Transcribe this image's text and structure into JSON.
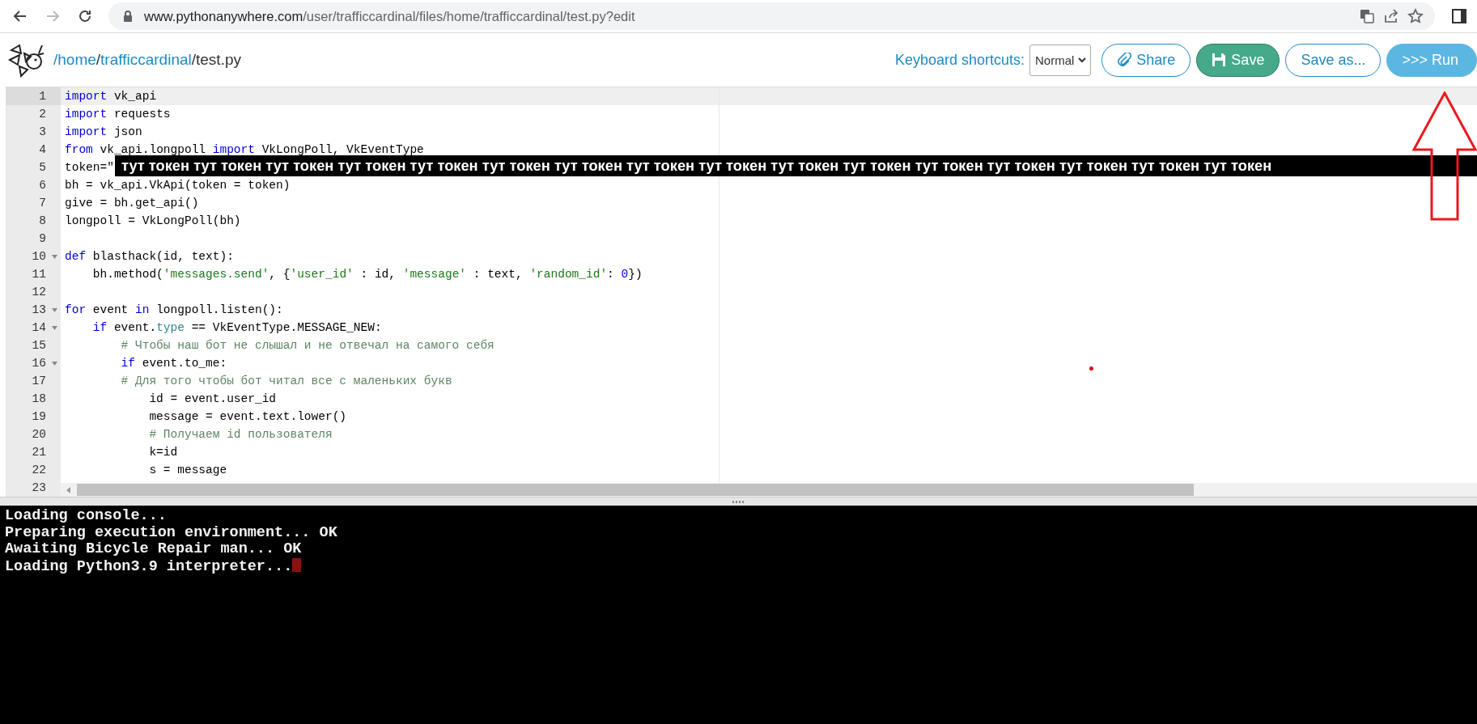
{
  "browser": {
    "nav_buttons": [
      {
        "kind": "back",
        "disabled": false
      },
      {
        "kind": "forward",
        "disabled": true
      },
      {
        "kind": "reload",
        "disabled": false
      }
    ],
    "url_host": "www.pythonanywhere.com",
    "url_path": "/user/trafficcardinal/files/home/trafficcardinal/test.py?edit"
  },
  "header": {
    "path": [
      {
        "kind": "link",
        "text": "/home"
      },
      {
        "kind": "text",
        "text": "/"
      },
      {
        "kind": "link",
        "text": "trafficcardinal"
      },
      {
        "kind": "text",
        "text": "/test.py"
      }
    ],
    "shortcuts_label": "Keyboard shortcuts:",
    "keymap": "Normal",
    "buttons": [
      {
        "kind": "share",
        "label": "Share"
      },
      {
        "kind": "save",
        "label": "Save"
      },
      {
        "kind": "saveas",
        "label": "Save as..."
      },
      {
        "kind": "run",
        "label": ">>> Run"
      }
    ]
  },
  "editor": {
    "lines": [
      {
        "number": "1",
        "active": true,
        "fold": false,
        "tokens": [
          {
            "kind": "kw",
            "text": "import"
          },
          {
            "kind": "plain",
            "text": " vk_api"
          }
        ]
      },
      {
        "number": "2",
        "active": false,
        "fold": false,
        "tokens": [
          {
            "kind": "kw",
            "text": "import"
          },
          {
            "kind": "plain",
            "text": " requests"
          }
        ]
      },
      {
        "number": "3",
        "active": false,
        "fold": false,
        "tokens": [
          {
            "kind": "kw",
            "text": "import"
          },
          {
            "kind": "plain",
            "text": " json"
          }
        ]
      },
      {
        "number": "4",
        "active": false,
        "fold": false,
        "tokens": [
          {
            "kind": "kw",
            "text": "from"
          },
          {
            "kind": "plain",
            "text": " vk_api.longpoll "
          },
          {
            "kind": "kw",
            "text": "import"
          },
          {
            "kind": "plain",
            "text": " VkLongPoll, VkEventType"
          }
        ]
      },
      {
        "number": "5",
        "active": false,
        "fold": false,
        "tokens": [
          {
            "kind": "plain",
            "text": "token=\""
          }
        ]
      },
      {
        "number": "6",
        "active": false,
        "fold": false,
        "tokens": [
          {
            "kind": "plain",
            "text": "bh = vk_api.VkApi(token = token)"
          }
        ]
      },
      {
        "number": "7",
        "active": false,
        "fold": false,
        "tokens": [
          {
            "kind": "plain",
            "text": "give = bh.get_api()"
          }
        ]
      },
      {
        "number": "8",
        "active": false,
        "fold": false,
        "tokens": [
          {
            "kind": "plain",
            "text": "longpoll = VkLongPoll(bh)"
          }
        ]
      },
      {
        "number": "9",
        "active": false,
        "fold": false
      },
      {
        "number": "10",
        "active": false,
        "fold": true,
        "tokens": [
          {
            "kind": "kw",
            "text": "def"
          },
          {
            "kind": "plain",
            "text": " blasthack(id, text):"
          }
        ]
      },
      {
        "number": "11",
        "active": false,
        "fold": false,
        "tokens": [
          {
            "kind": "plain",
            "text": "    bh.method("
          },
          {
            "kind": "str",
            "text": "'messages.send'"
          },
          {
            "kind": "plain",
            "text": ", {"
          },
          {
            "kind": "str",
            "text": "'user_id'"
          },
          {
            "kind": "plain",
            "text": " : id, "
          },
          {
            "kind": "str",
            "text": "'message'"
          },
          {
            "kind": "plain",
            "text": " : text, "
          },
          {
            "kind": "str",
            "text": "'random_id'"
          },
          {
            "kind": "plain",
            "text": ": "
          },
          {
            "kind": "num",
            "text": "0"
          },
          {
            "kind": "plain",
            "text": "})"
          }
        ]
      },
      {
        "number": "12",
        "active": false,
        "fold": false
      },
      {
        "number": "13",
        "active": false,
        "fold": true,
        "tokens": [
          {
            "kind": "kw",
            "text": "for"
          },
          {
            "kind": "plain",
            "text": " event "
          },
          {
            "kind": "kw",
            "text": "in"
          },
          {
            "kind": "plain",
            "text": " longpoll.listen():"
          }
        ]
      },
      {
        "number": "14",
        "active": false,
        "fold": true,
        "tokens": [
          {
            "kind": "kw",
            "text": "    if"
          },
          {
            "kind": "plain",
            "text": " event."
          },
          {
            "kind": "builtin",
            "text": "type"
          },
          {
            "kind": "plain",
            "text": " == VkEventType.MESSAGE_NEW:"
          }
        ]
      },
      {
        "number": "15",
        "active": false,
        "fold": false,
        "tokens": [
          {
            "kind": "com",
            "text": "        # Чтобы наш бот не слышал и не отвечал на самого себя"
          }
        ]
      },
      {
        "number": "16",
        "active": false,
        "fold": true,
        "tokens": [
          {
            "kind": "kw",
            "text": "        if"
          },
          {
            "kind": "plain",
            "text": " event.to_me:"
          }
        ]
      },
      {
        "number": "17",
        "active": false,
        "fold": false,
        "tokens": [
          {
            "kind": "com",
            "text": "        # Для того чтобы бот читал все с маленьких букв"
          }
        ]
      },
      {
        "number": "18",
        "active": false,
        "fold": false,
        "tokens": [
          {
            "kind": "plain",
            "text": "            id = event.user_id"
          }
        ]
      },
      {
        "number": "19",
        "active": false,
        "fold": false,
        "tokens": [
          {
            "kind": "plain",
            "text": "            message = event.text.lower()"
          }
        ]
      },
      {
        "number": "20",
        "active": false,
        "fold": false,
        "tokens": [
          {
            "kind": "com",
            "text": "            # Получаем id пользователя"
          }
        ]
      },
      {
        "number": "21",
        "active": false,
        "fold": false,
        "tokens": [
          {
            "kind": "plain",
            "text": "            k=id"
          }
        ]
      },
      {
        "number": "22",
        "active": false,
        "fold": false,
        "tokens": [
          {
            "kind": "plain",
            "text": "            s = message"
          }
        ]
      },
      {
        "number": "23",
        "active": false,
        "fold": false
      }
    ]
  },
  "overlay": {
    "text": "тут токен тут токен тут токен тут токен тут токен тут токен тут токен тут токен тут токен тут токен тут токен тут токен тут токен тут токен тут токен тут токен"
  },
  "console": {
    "lines": [
      "Loading console...",
      "Preparing execution environment... OK",
      "Awaiting Bicycle Repair man... OK",
      "Loading Python3.9 interpreter..."
    ],
    "cursor": true
  }
}
